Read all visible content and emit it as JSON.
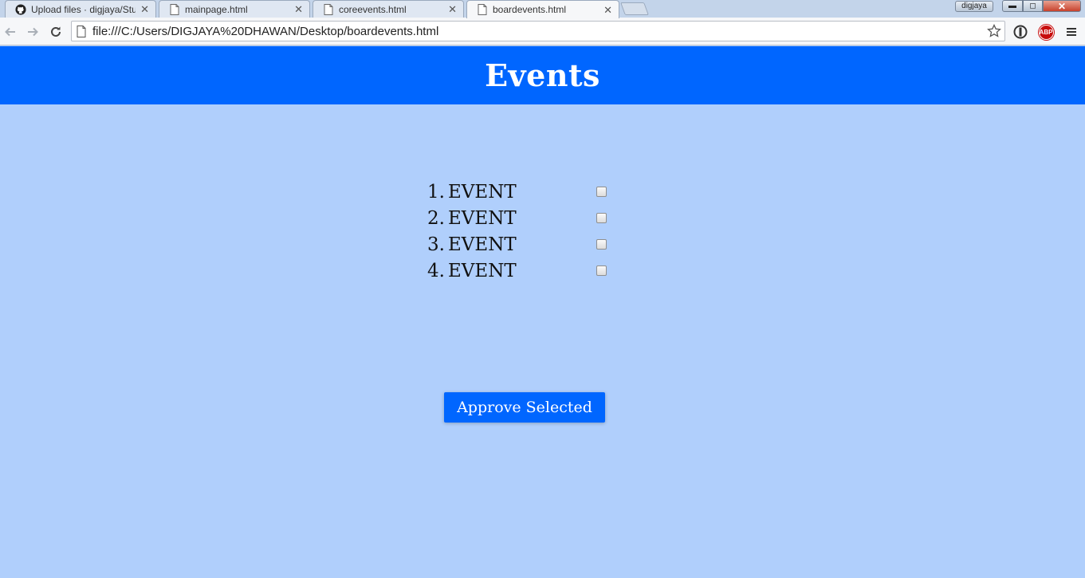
{
  "browser": {
    "tabs": [
      {
        "title": "Upload files · digjaya/Stuc",
        "icon": "github-icon"
      },
      {
        "title": "mainpage.html",
        "icon": "page-icon"
      },
      {
        "title": "coreevents.html",
        "icon": "page-icon"
      },
      {
        "title": "boardevents.html",
        "icon": "page-icon",
        "active": true
      }
    ],
    "tab_close": "✕",
    "profile_name": "digjaya",
    "window_controls": {
      "minimize": "▬",
      "maximize": "◻",
      "close": "✕"
    },
    "address": "file:///C:/Users/DIGJAYA%20DHAWAN/Desktop/boardevents.html",
    "extension_abp": "ABP"
  },
  "page": {
    "title": "Events",
    "events": [
      {
        "number": "1.",
        "label": "EVENT",
        "checked": false
      },
      {
        "number": "2.",
        "label": "EVENT",
        "checked": false
      },
      {
        "number": "3.",
        "label": "EVENT",
        "checked": false
      },
      {
        "number": "4.",
        "label": "EVENT",
        "checked": false
      }
    ],
    "approve_button": "Approve Selected"
  },
  "colors": {
    "header_bg": "#0066ff",
    "page_bg": "#b0cffc",
    "button_bg": "#0066ff"
  }
}
